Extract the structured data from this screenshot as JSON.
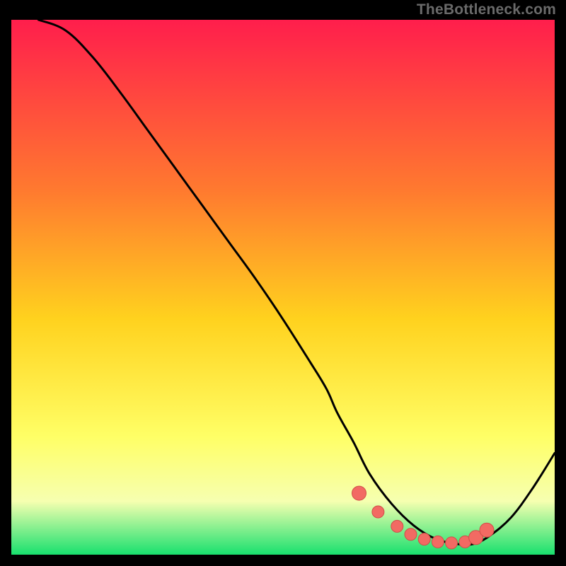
{
  "watermark": "TheBottleneck.com",
  "colors": {
    "frame": "#000000",
    "grad_top": "#ff1e4c",
    "grad_mid1": "#ff7a2f",
    "grad_mid2": "#ffd21e",
    "grad_mid3": "#ffff66",
    "grad_low": "#f6ffb0",
    "grad_bottom": "#18e06e",
    "curve": "#000000",
    "marker_fill": "#f26a63",
    "marker_stroke": "#d14e48"
  },
  "chart_data": {
    "type": "line",
    "title": "",
    "xlabel": "",
    "ylabel": "",
    "xlim": [
      0,
      100
    ],
    "ylim": [
      0,
      100
    ],
    "series": [
      {
        "name": "curve",
        "x": [
          5,
          10,
          15,
          20,
          25,
          30,
          35,
          40,
          45,
          50,
          55,
          58,
          60,
          63,
          66,
          70,
          74,
          78,
          82,
          85,
          88,
          92,
          96,
          100
        ],
        "y": [
          100,
          98,
          93,
          86.5,
          79.5,
          72.5,
          65.5,
          58.5,
          51.5,
          44,
          36,
          31,
          26.5,
          21,
          15,
          9.5,
          5.5,
          3,
          2,
          2,
          3.5,
          7,
          12.5,
          19
        ]
      }
    ],
    "markers": {
      "name": "bottom-cluster",
      "x": [
        64,
        67.5,
        71,
        73.5,
        76,
        78.5,
        81,
        83.5,
        85.5,
        87.5
      ],
      "y": [
        11.5,
        8,
        5.3,
        3.8,
        2.9,
        2.4,
        2.2,
        2.4,
        3.2,
        4.6
      ]
    },
    "gradient_stops": [
      {
        "offset": 0.0,
        "key": "grad_top"
      },
      {
        "offset": 0.32,
        "key": "grad_mid1"
      },
      {
        "offset": 0.56,
        "key": "grad_mid2"
      },
      {
        "offset": 0.78,
        "key": "grad_mid3"
      },
      {
        "offset": 0.9,
        "key": "grad_low"
      },
      {
        "offset": 1.0,
        "key": "grad_bottom"
      }
    ]
  }
}
